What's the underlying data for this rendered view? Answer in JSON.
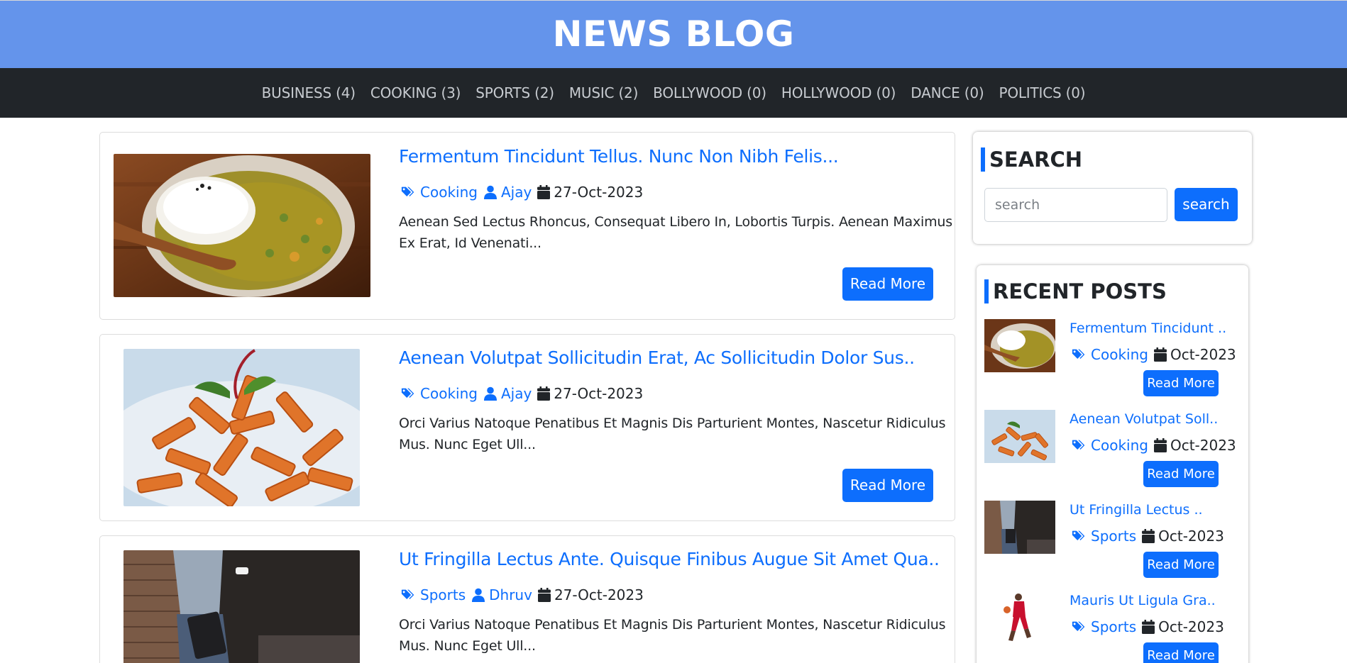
{
  "site": {
    "title": "NEWS BLOG"
  },
  "nav": [
    "BUSINESS (4)",
    "COOKING (3)",
    "SPORTS (2)",
    "MUSIC (2)",
    "BOLLYWOOD (0)",
    "HOLLYWOOD (0)",
    "DANCE (0)",
    "POLITICS (0)"
  ],
  "posts": [
    {
      "title": "Fermentum Tincidunt Tellus. Nunc Non Nibh Felis...",
      "category": "Cooking",
      "author": "Ajay",
      "date": "27-Oct-2023",
      "excerpt": "Aenean Sed Lectus Rhoncus, Consequat Libero In, Lobortis Turpis. Aenean Maximus Ex Erat, Id Venenati...",
      "button": "Read More"
    },
    {
      "title": "Aenean Volutpat Sollicitudin Erat, Ac Sollicitudin Dolor Sus..",
      "category": "Cooking",
      "author": "Ajay",
      "date": "27-Oct-2023",
      "excerpt": "Orci Varius Natoque Penatibus Et Magnis Dis Parturient Montes, Nascetur Ridiculus Mus. Nunc Eget Ull...",
      "button": "Read More"
    },
    {
      "title": "Ut Fringilla Lectus Ante. Quisque Finibus Augue Sit Amet Qua..",
      "category": "Sports",
      "author": "Dhruv",
      "date": "27-Oct-2023",
      "excerpt": "Orci Varius Natoque Penatibus Et Magnis Dis Parturient Montes, Nascetur Ridiculus Mus. Nunc Eget Ull..."
    }
  ],
  "search": {
    "title": "SEARCH",
    "placeholder": "search",
    "button": "search"
  },
  "recent": {
    "title": "RECENT POSTS",
    "items": [
      {
        "title": "Fermentum Tincidunt ..",
        "category": "Cooking",
        "date": "Oct-2023",
        "button": "Read More"
      },
      {
        "title": "Aenean Volutpat Soll..",
        "category": "Cooking",
        "date": "Oct-2023",
        "button": "Read More"
      },
      {
        "title": "Ut Fringilla Lectus ..",
        "category": "Sports",
        "date": "Oct-2023",
        "button": "Read More"
      },
      {
        "title": "Mauris Ut Ligula Gra..",
        "category": "Sports",
        "date": "Oct-2023",
        "button": "Read More"
      }
    ]
  },
  "colors": {
    "header": "#6494eb",
    "nav": "#212529",
    "accent": "#0d6efd"
  },
  "icons": {
    "category": "tags-icon",
    "author": "user-icon",
    "date": "calendar-icon"
  }
}
